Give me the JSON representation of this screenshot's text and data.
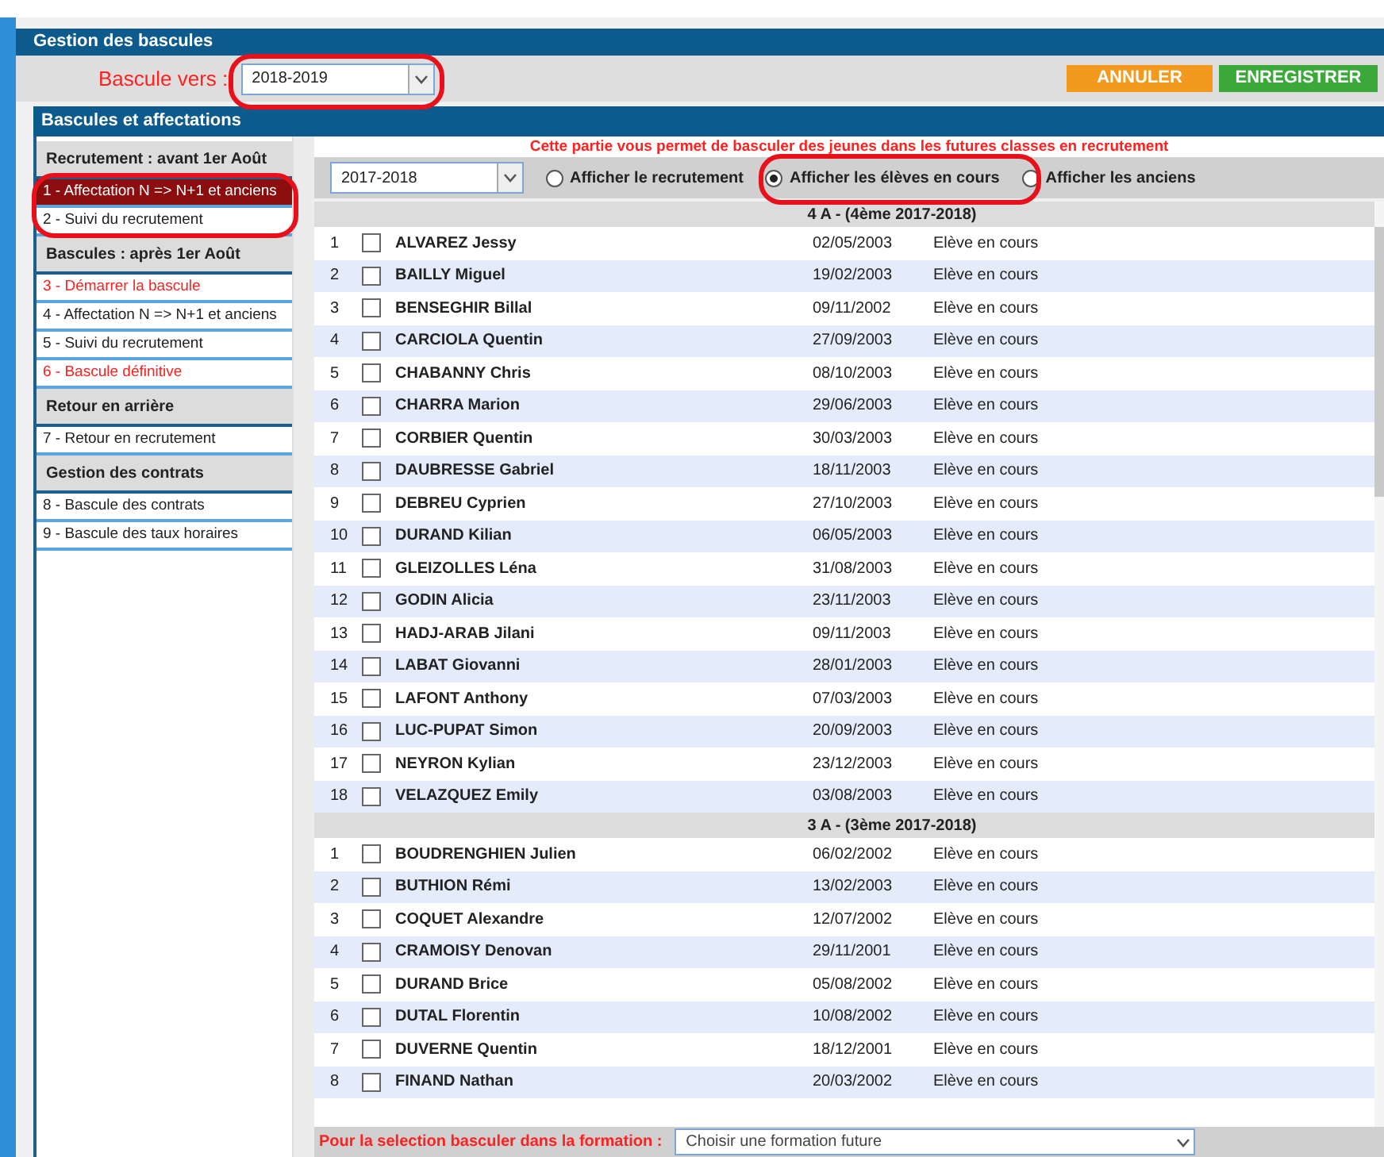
{
  "window": {
    "title": "Gestion des bascules"
  },
  "toolbar": {
    "label": "Bascule vers :",
    "select": "2018-2019",
    "buttons": [
      {
        "label": "ANNULER",
        "kind": "cancel"
      },
      {
        "label": "ENREGISTRER",
        "kind": "save"
      }
    ]
  },
  "panel": {
    "title": "Bascules et affectations"
  },
  "sidebar": [
    {
      "kind": "header",
      "label": "Recrutement : avant 1er Août"
    },
    {
      "kind": "item",
      "label": "1 - Affectation N => N+1 et anciens",
      "selected": true
    },
    {
      "kind": "item",
      "label": "2 - Suivi du recrutement",
      "selected": false,
      "color": "#222222"
    },
    {
      "kind": "header",
      "label": "Bascules : après 1er Août"
    },
    {
      "kind": "item",
      "label": "3 - Démarrer la bascule",
      "selected": false,
      "color": "#ff2020"
    },
    {
      "kind": "item",
      "label": "4 - Affectation N => N+1 et anciens",
      "selected": false,
      "color": "#222222"
    },
    {
      "kind": "item",
      "label": "5 - Suivi du recrutement",
      "selected": false,
      "color": "#222222"
    },
    {
      "kind": "item",
      "label": "6 - Bascule définitive",
      "selected": false,
      "color": "#ff2020"
    },
    {
      "kind": "header",
      "label": "Retour en arrière"
    },
    {
      "kind": "item",
      "label": "7 - Retour en recrutement",
      "selected": false,
      "color": "#222222"
    },
    {
      "kind": "header",
      "label": "Gestion des contrats"
    },
    {
      "kind": "item",
      "label": "8 - Bascule des contrats",
      "selected": false,
      "color": "#222222"
    },
    {
      "kind": "item",
      "label": "9 - Bascule des taux horaires",
      "selected": false,
      "color": "#222222"
    }
  ],
  "notice": "Cette partie vous permet de basculer des jeunes dans les futures classes en recrutement",
  "filter": {
    "select": "2017-2018",
    "radios": [
      {
        "label": "Afficher le recrutement",
        "selected": false
      },
      {
        "label": "Afficher les élèves en cours",
        "selected": true
      },
      {
        "label": "Afficher les anciens",
        "selected": false
      }
    ]
  },
  "groups": [
    {
      "title": "4 A - (4ème 2017-2018)",
      "rows": [
        {
          "num": "1",
          "name": "ALVAREZ Jessy",
          "date": "02/05/2003",
          "status": "Elève en cours",
          "checked": false
        },
        {
          "num": "2",
          "name": "BAILLY Miguel",
          "date": "19/02/2003",
          "status": "Elève en cours",
          "checked": false
        },
        {
          "num": "3",
          "name": "BENSEGHIR Billal",
          "date": "09/11/2002",
          "status": "Elève en cours",
          "checked": false
        },
        {
          "num": "4",
          "name": "CARCIOLA Quentin",
          "date": "27/09/2003",
          "status": "Elève en cours",
          "checked": false
        },
        {
          "num": "5",
          "name": "CHABANNY Chris",
          "date": "08/10/2003",
          "status": "Elève en cours",
          "checked": false
        },
        {
          "num": "6",
          "name": "CHARRA Marion",
          "date": "29/06/2003",
          "status": "Elève en cours",
          "checked": false
        },
        {
          "num": "7",
          "name": "CORBIER Quentin",
          "date": "30/03/2003",
          "status": "Elève en cours",
          "checked": false
        },
        {
          "num": "8",
          "name": "DAUBRESSE Gabriel",
          "date": "18/11/2003",
          "status": "Elève en cours",
          "checked": false
        },
        {
          "num": "9",
          "name": "DEBREU Cyprien",
          "date": "27/10/2003",
          "status": "Elève en cours",
          "checked": false
        },
        {
          "num": "10",
          "name": "DURAND Kilian",
          "date": "06/05/2003",
          "status": "Elève en cours",
          "checked": false
        },
        {
          "num": "11",
          "name": "GLEIZOLLES Léna",
          "date": "31/08/2003",
          "status": "Elève en cours",
          "checked": false
        },
        {
          "num": "12",
          "name": "GODIN Alicia",
          "date": "23/11/2003",
          "status": "Elève en cours",
          "checked": false
        },
        {
          "num": "13",
          "name": "HADJ-ARAB Jilani",
          "date": "09/11/2003",
          "status": "Elève en cours",
          "checked": false
        },
        {
          "num": "14",
          "name": "LABAT Giovanni",
          "date": "28/01/2003",
          "status": "Elève en cours",
          "checked": false
        },
        {
          "num": "15",
          "name": "LAFONT Anthony",
          "date": "07/03/2003",
          "status": "Elève en cours",
          "checked": false
        },
        {
          "num": "16",
          "name": "LUC-PUPAT Simon",
          "date": "20/09/2003",
          "status": "Elève en cours",
          "checked": false
        },
        {
          "num": "17",
          "name": "NEYRON Kylian",
          "date": "23/12/2003",
          "status": "Elève en cours",
          "checked": false
        },
        {
          "num": "18",
          "name": "VELAZQUEZ Emily",
          "date": "03/08/2003",
          "status": "Elève en cours",
          "checked": false
        }
      ]
    },
    {
      "title": "3 A - (3ème 2017-2018)",
      "rows": [
        {
          "num": "1",
          "name": "BOUDRENGHIEN Julien",
          "date": "06/02/2002",
          "status": "Elève en cours",
          "checked": false
        },
        {
          "num": "2",
          "name": "BUTHION Rémi",
          "date": "13/02/2003",
          "status": "Elève en cours",
          "checked": false
        },
        {
          "num": "3",
          "name": "COQUET Alexandre",
          "date": "12/07/2002",
          "status": "Elève en cours",
          "checked": false
        },
        {
          "num": "4",
          "name": "CRAMOISY Denovan",
          "date": "29/11/2001",
          "status": "Elève en cours",
          "checked": false
        },
        {
          "num": "5",
          "name": "DURAND Brice",
          "date": "05/08/2002",
          "status": "Elève en cours",
          "checked": false
        },
        {
          "num": "6",
          "name": "DUTAL Florentin",
          "date": "10/08/2002",
          "status": "Elève en cours",
          "checked": false
        },
        {
          "num": "7",
          "name": "DUVERNE Quentin",
          "date": "18/12/2001",
          "status": "Elève en cours",
          "checked": false
        },
        {
          "num": "8",
          "name": "FINAND Nathan",
          "date": "20/03/2002",
          "status": "Elève en cours",
          "checked": false
        }
      ]
    }
  ],
  "footer": {
    "label": "Pour la selection basculer dans la formation :",
    "select_placeholder": "Choisir une formation future"
  }
}
